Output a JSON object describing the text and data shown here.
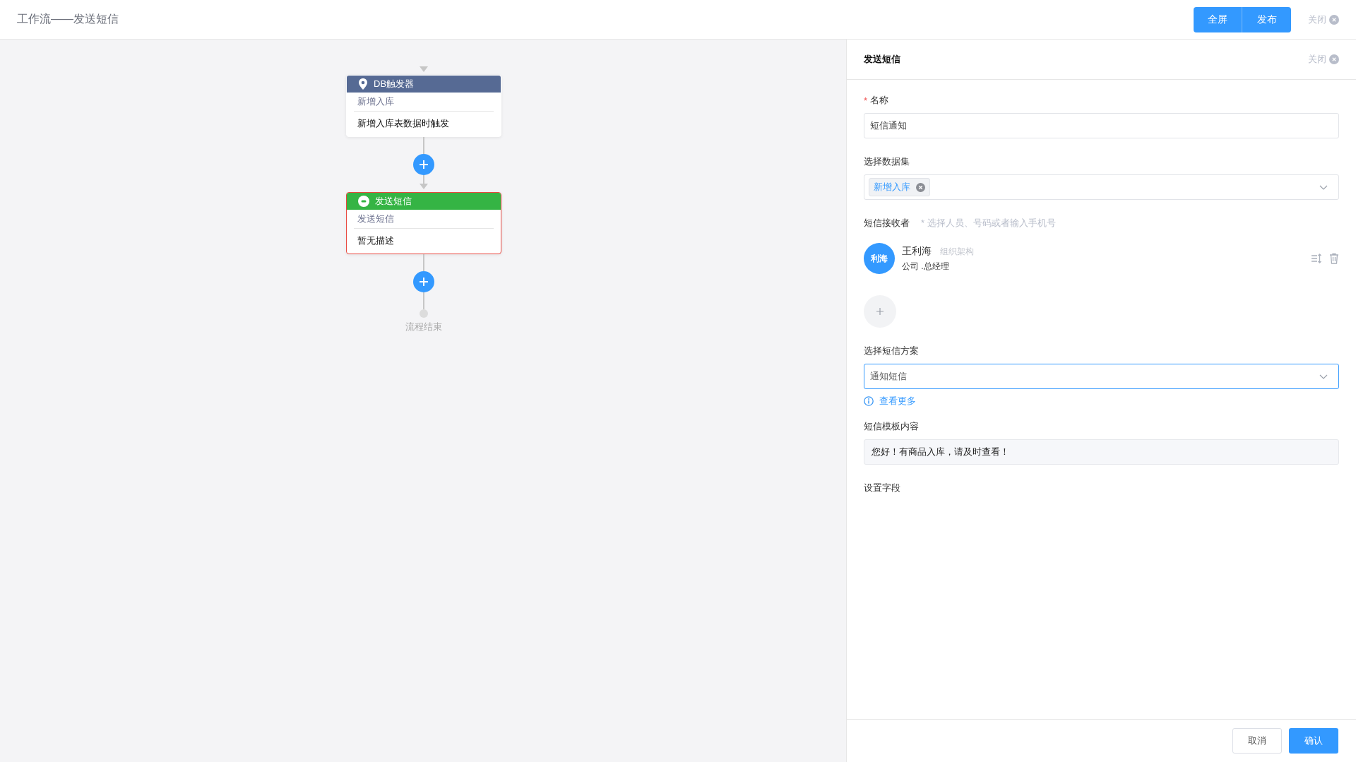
{
  "header": {
    "title": "工作流——发送短信",
    "buttons": [
      "全屏",
      "发布"
    ],
    "close": "关闭"
  },
  "flow": {
    "nodes": [
      {
        "kind": "trigger",
        "title": "DB触发器",
        "color": "#566a94",
        "subtitle": "新增入库",
        "description": "新增入库表数据时触发",
        "selected": false
      },
      {
        "kind": "sms",
        "title": "发送短信",
        "color": "#35b444",
        "subtitle": "发送短信",
        "description": "暂无描述",
        "selected": true
      }
    ],
    "end_label": "流程结束"
  },
  "panel": {
    "title": "发送短信",
    "close": "关闭",
    "name": {
      "required_mark": "*",
      "label": "名称",
      "value": "短信通知"
    },
    "dataset": {
      "label": "选择数据集",
      "tags": [
        "新增入库"
      ]
    },
    "recipients": {
      "label": "短信接收者",
      "hint": "* 选择人员、号码或者输入手机号",
      "people": [
        {
          "avatar": "利海",
          "name": "王利海",
          "source": "组织架构",
          "position": "公司 .总经理"
        }
      ]
    },
    "scheme": {
      "label": "选择短信方案",
      "value": "通知短信",
      "focused": true,
      "more_link": "查看更多"
    },
    "template": {
      "label": "短信模板内容",
      "value": "您好！有商品入库，请及时查看！"
    },
    "fields_label": "设置字段"
  },
  "footer": {
    "cancel": "取消",
    "confirm": "确认"
  }
}
